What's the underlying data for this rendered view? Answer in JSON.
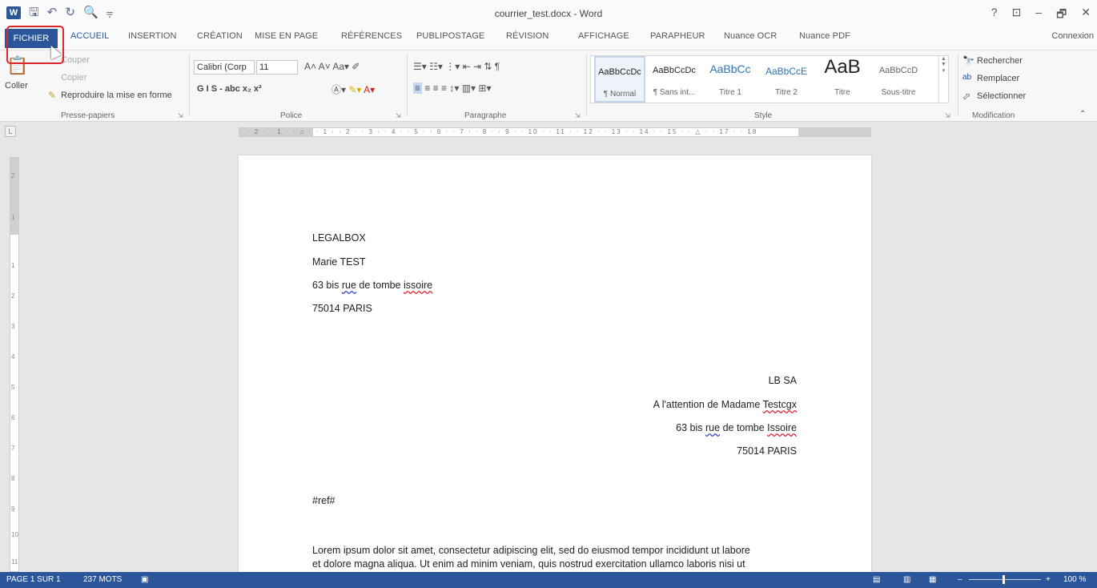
{
  "window": {
    "title": "courrier_test.docx - Word",
    "controls": [
      "?",
      "⊡",
      "–",
      "🗗",
      "✕"
    ]
  },
  "qat": {
    "icons": [
      "word-icon",
      "save-icon",
      "undo-icon",
      "redo-icon",
      "print-preview-icon",
      "customize-icon"
    ]
  },
  "tabs": [
    {
      "label": "FICHIER"
    },
    {
      "label": "ACCUEIL"
    },
    {
      "label": "INSERTION"
    },
    {
      "label": "CRÉATION"
    },
    {
      "label": "MISE EN PAGE"
    },
    {
      "label": "RÉFÉRENCES"
    },
    {
      "label": "PUBLIPOSTAGE"
    },
    {
      "label": "RÉVISION"
    },
    {
      "label": "AFFICHAGE"
    },
    {
      "label": "PARAPHEUR"
    },
    {
      "label": "Nuance OCR"
    },
    {
      "label": "Nuance PDF"
    }
  ],
  "connexion": "Connexion",
  "ribbon": {
    "clipboard": {
      "paste": "Coller",
      "cut": "Couper",
      "copy": "Copier",
      "format_painter": "Reproduire la mise en forme",
      "label": "Presse-papiers"
    },
    "font": {
      "name": "Calibri (Corp",
      "size": "11",
      "label": "Police",
      "row2": "G  I  S  -  abc  x₂  x²"
    },
    "paragraph": {
      "label": "Paragraphe"
    },
    "styles": {
      "label": "Style",
      "items": [
        {
          "sample": "AaBbCcDc",
          "name": "¶ Normal"
        },
        {
          "sample": "AaBbCcDc",
          "name": "¶ Sans int..."
        },
        {
          "sample": "AaBbCc",
          "name": "Titre 1"
        },
        {
          "sample": "AaBbCcE",
          "name": "Titre 2"
        },
        {
          "sample": "AaB",
          "name": "Titre"
        },
        {
          "sample": "AaBbCcD",
          "name": "Sous-titre"
        }
      ]
    },
    "editing": {
      "label": "Modification",
      "find": "Rechercher",
      "replace": "Remplacer",
      "select": "Sélectionner"
    }
  },
  "ruler": {
    "corner": "L",
    "ticks": "· 2 · · 1 · · ⌂ · · 1 · · 2 · · 3 · · 4 · · 5 · · 6 · · 7 · · 8 · · 9 · · 10 · · 11 · · 12 · · 13 · · 14 · · 15 · · △ · · 17 · · 18",
    "vertical": [
      "2",
      "1",
      "1",
      "2",
      "3",
      "4",
      "5",
      "6",
      "7",
      "8",
      "9",
      "10",
      "11"
    ]
  },
  "document": {
    "sender": [
      "LEGALBOX",
      "Marie TEST"
    ],
    "sender_addr": {
      "pre": "63 bis ",
      "rue": "rue",
      "mid": " de tombe ",
      "issoire": "issoire"
    },
    "sender_city": "75014 PARIS",
    "recipient_name": "LB SA",
    "recipient_attn_pre": "A l'attention de Madame ",
    "recipient_attn_name": "Testcgx",
    "recipient_addr": {
      "pre": "63 bis ",
      "rue": "rue",
      "mid": " de tombe ",
      "issoire": "Issoire"
    },
    "recipient_city": "75014 PARIS",
    "ref": "#ref#",
    "body_1": "Lorem ipsum dolor sit amet, consectetur adipiscing elit, sed do eiusmod tempor incididunt ut labore",
    "body_2": "et dolore magna aliqua. Ut enim ad minim veniam, quis nostrud exercitation ullamco laboris nisi ut"
  },
  "status": {
    "page": "PAGE 1 SUR 1",
    "words": "237 MOTS",
    "zoom": "100 %"
  },
  "colors": {
    "accent": "#2b579a",
    "highlight": "#e0262b"
  }
}
